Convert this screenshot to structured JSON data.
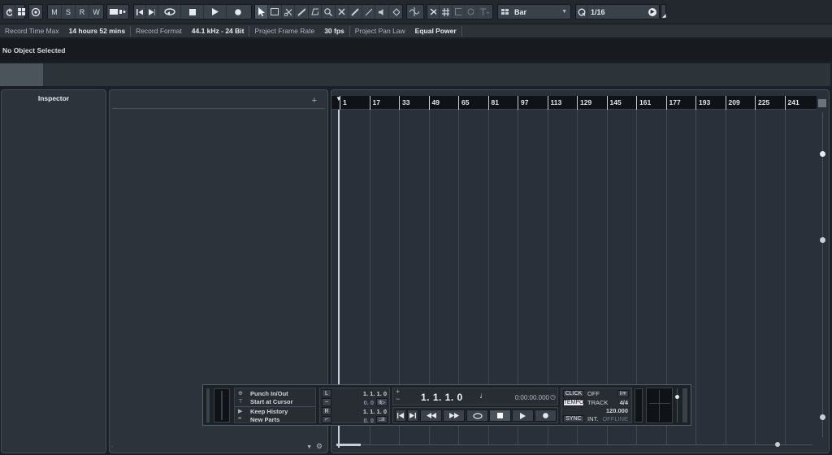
{
  "toolbar": {
    "msrw": [
      "M",
      "S",
      "R",
      "W"
    ],
    "snap_type": "Bar",
    "quantize": "1/16"
  },
  "status_bar": [
    {
      "label": "Record Time Max",
      "value": "14 hours 52 mins"
    },
    {
      "label": "Record Format",
      "value": "44.1 kHz - 24 Bit"
    },
    {
      "label": "Project Frame Rate",
      "value": "30 fps"
    },
    {
      "label": "Project Pan Law",
      "value": "Equal Power"
    }
  ],
  "info_line": "No Object Selected",
  "inspector": {
    "title": "Inspector"
  },
  "track_list": {
    "add_label": "+"
  },
  "ruler": {
    "bars": [
      "1",
      "17",
      "33",
      "49",
      "65",
      "81",
      "97",
      "113",
      "129",
      "145",
      "161",
      "177",
      "193",
      "209",
      "225",
      "241"
    ]
  },
  "transport": {
    "options": [
      "Punch In/Out",
      "Start at Cursor",
      "Keep History",
      "New Parts"
    ],
    "left_locator": "1.  1.  1.    0",
    "right_locator": "1.  1.  1.    0",
    "pre_roll": "0.    0",
    "post_roll": "0.    0",
    "position_primary": "1.  1.  1.    0",
    "position_secondary": "0:00:00.000",
    "click_label": "CLICK",
    "click_value": "OFF",
    "tempo_label": "TEMPO",
    "tempo_mode": "TRACK",
    "signature": "4/4",
    "tempo_value": "120.000",
    "sync_label": "SYNC",
    "sync_mode": "INT.",
    "sync_status": "OFFLINE"
  },
  "colors": {
    "accent": "#3a4149",
    "background": "#1b2026",
    "panel": "#2c333a"
  }
}
